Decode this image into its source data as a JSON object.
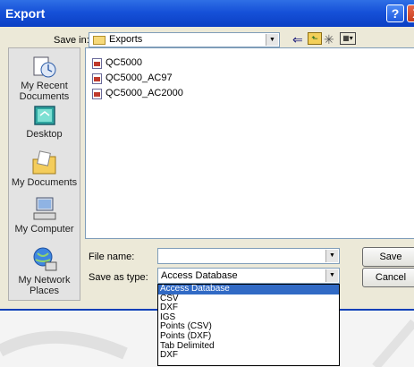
{
  "window": {
    "title": "Export",
    "help_glyph": "?",
    "close_glyph": "X"
  },
  "save_in": {
    "label": "Save in:",
    "value": "Exports"
  },
  "places": [
    {
      "label": "My Recent Documents",
      "icon": "recent-documents-icon"
    },
    {
      "label": "Desktop",
      "icon": "desktop-icon"
    },
    {
      "label": "My Documents",
      "icon": "my-documents-icon"
    },
    {
      "label": "My Computer",
      "icon": "my-computer-icon"
    },
    {
      "label": "My Network Places",
      "icon": "network-places-icon"
    }
  ],
  "files": [
    "QC5000",
    "QC5000_AC97",
    "QC5000_AC2000"
  ],
  "file_name": {
    "label": "File name:",
    "value": ""
  },
  "save_as_type": {
    "label": "Save as type:",
    "value": "Access Database",
    "options": [
      "Access Database",
      "CSV",
      "DXF",
      "IGS",
      "Points (CSV)",
      "Points (DXF)",
      "Tab Delimited",
      "DXF"
    ],
    "selected_index": 0
  },
  "buttons": {
    "save": "Save",
    "cancel": "Cancel"
  },
  "colors": {
    "titlebar": "#1651d8",
    "selection": "#316ac5",
    "dialog_bg": "#ece9d8"
  }
}
